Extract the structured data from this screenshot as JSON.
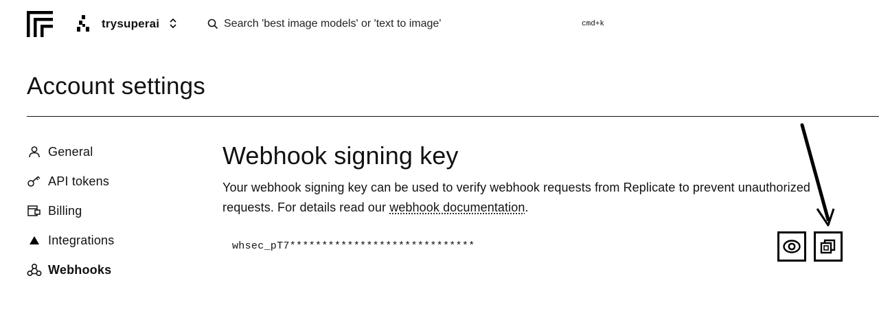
{
  "header": {
    "org_name": "trysuperai",
    "search_placeholder": "Search 'best image models' or 'text to image'",
    "shortcut": "cmd+k"
  },
  "page": {
    "title": "Account settings"
  },
  "sidebar": {
    "items": [
      {
        "label": "General",
        "icon": "user-icon",
        "active": false
      },
      {
        "label": "API tokens",
        "icon": "key-icon",
        "active": false
      },
      {
        "label": "Billing",
        "icon": "billing-icon",
        "active": false
      },
      {
        "label": "Integrations",
        "icon": "triangle-icon",
        "active": false
      },
      {
        "label": "Webhooks",
        "icon": "webhook-icon",
        "active": true
      }
    ]
  },
  "main": {
    "title": "Webhook signing key",
    "description_before": "Your webhook signing key can be used to verify webhook requests from Replicate to prevent unauthorized requests. For details read our ",
    "description_link": "webhook documentation",
    "description_after": ".",
    "key_value": "whsec_pT7*****************************",
    "reveal_icon": "eye-icon",
    "copy_icon": "copy-icon"
  }
}
